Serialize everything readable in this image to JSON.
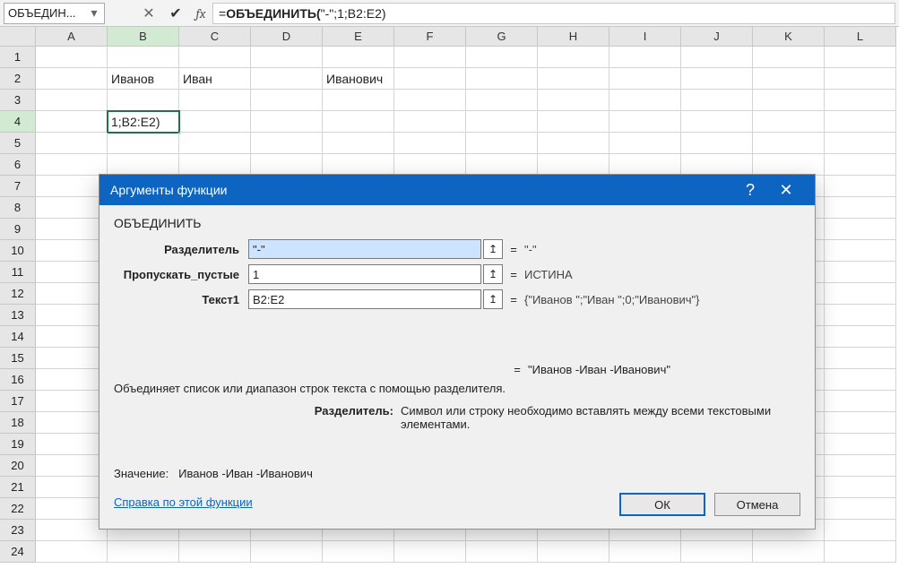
{
  "nameBox": "ОБЪЕДИН...",
  "formula": {
    "prefix": "=",
    "bold": "ОБЪЕДИНИТЬ(",
    "rest": "\"-\";1;B2:E2)"
  },
  "columns": [
    "A",
    "B",
    "C",
    "D",
    "E",
    "F",
    "G",
    "H",
    "I",
    "J",
    "K",
    "L"
  ],
  "rows": 24,
  "activeCol": "B",
  "activeRow": 4,
  "cells": {
    "B2": "Иванов",
    "C2": "Иван",
    "E2": "Иванович",
    "B4": "1;B2:E2)"
  },
  "dialog": {
    "title": "Аргументы функции",
    "fnName": "ОБЪЕДИНИТЬ",
    "args": [
      {
        "label": "Разделитель",
        "input": "\"-\"",
        "value": "\"-\"",
        "highlight": true
      },
      {
        "label": "Пропускать_пустые",
        "input": "1",
        "value": "ИСТИНА",
        "highlight": false
      },
      {
        "label": "Текст1",
        "input": "B2:E2",
        "value": "{\"Иванов \";\"Иван \";0;\"Иванович\"}",
        "highlight": false
      }
    ],
    "previewResult": "\"Иванов -Иван -Иванович\"",
    "description": "Объединяет список или диапазон строк текста с помощью разделителя.",
    "paramName": "Разделитель:",
    "paramDesc": "Символ или строку необходимо вставлять между всеми текстовыми элементами.",
    "valueLabel": "Значение:",
    "valueText": "Иванов -Иван -Иванович",
    "helpLink": "Справка по этой функции",
    "okLabel": "ОК",
    "cancelLabel": "Отмена"
  }
}
